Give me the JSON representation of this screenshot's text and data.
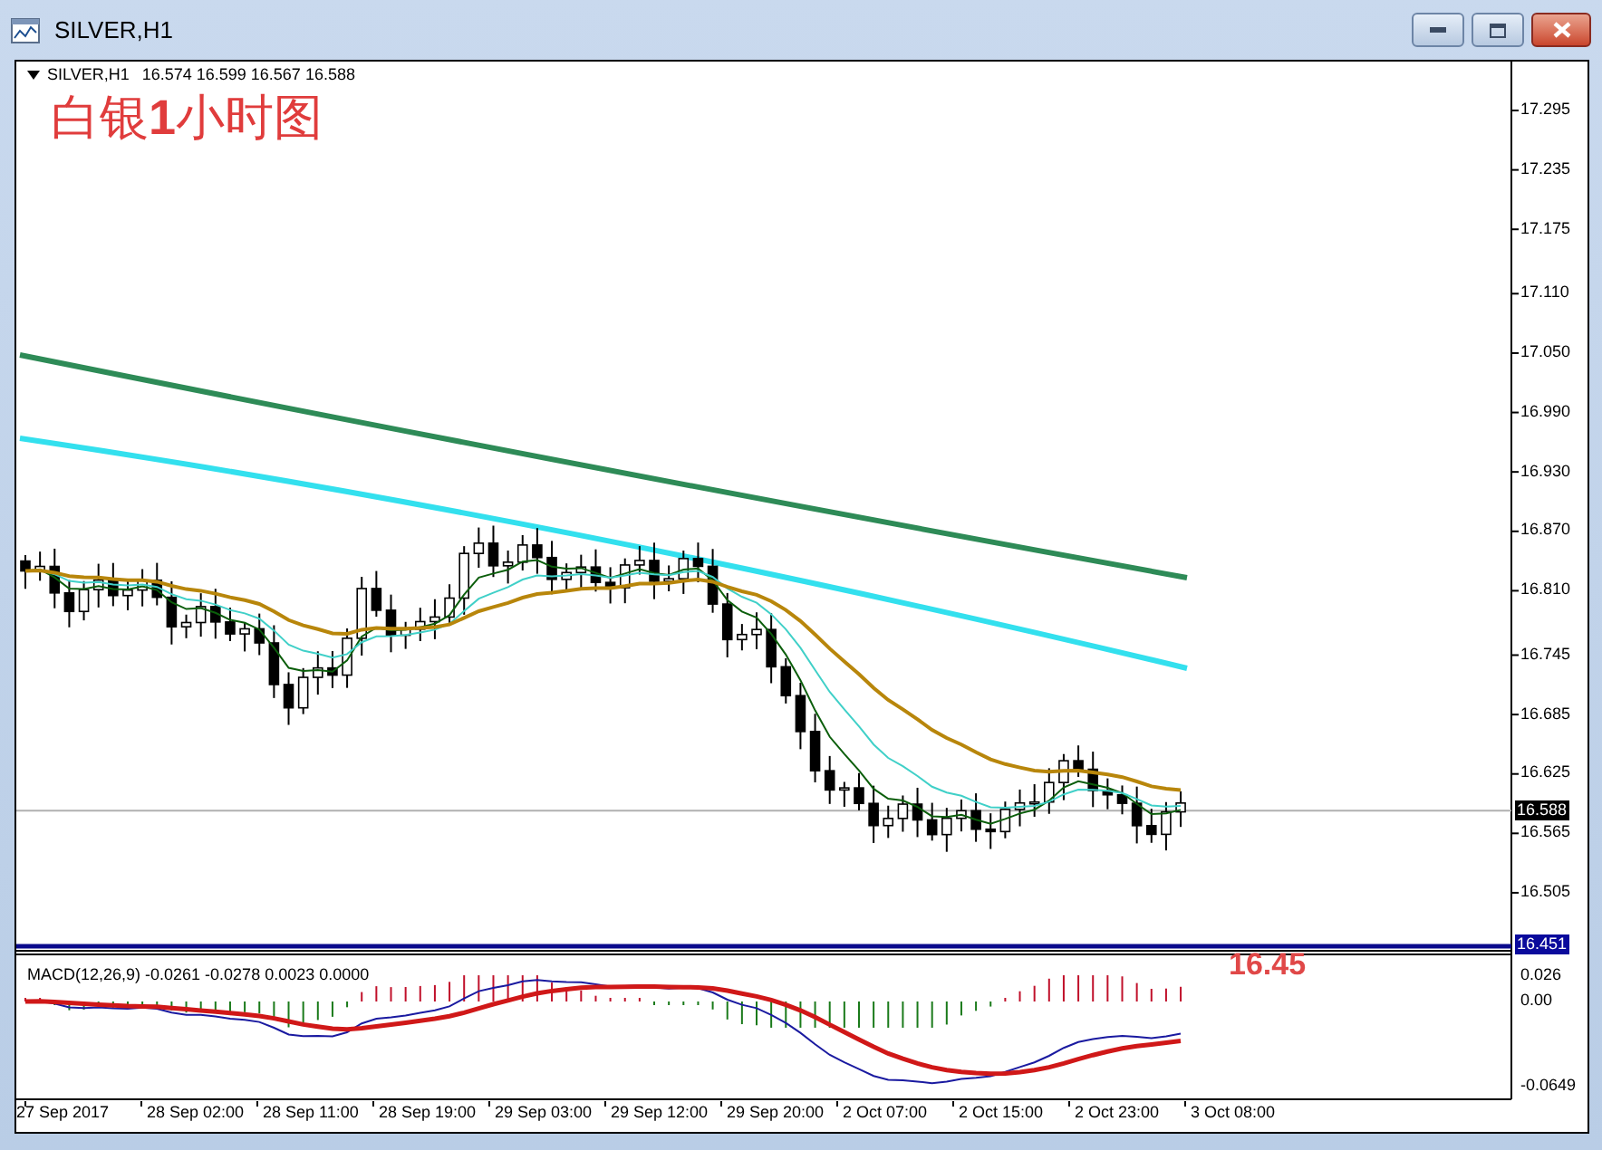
{
  "window": {
    "title": "SILVER,H1"
  },
  "chart": {
    "symbol": "SILVER,H1",
    "quote": "16.574 16.599 16.567 16.588",
    "overlay_title": "白银**1**小时图",
    "level_annotation": "16.45"
  },
  "price_axis": {
    "ticks": [
      "17.295",
      "17.235",
      "17.175",
      "17.110",
      "17.050",
      "16.990",
      "16.930",
      "16.870",
      "16.810",
      "16.745",
      "16.685",
      "16.625",
      "16.565",
      "16.505"
    ],
    "bid_label": "16.588",
    "level_label": "16.451"
  },
  "macd": {
    "label": "MACD(12,26,9) -0.0261 -0.0278 0.0023 0.0000",
    "ticks": [
      "0.026",
      "0.00",
      "-0.0649"
    ]
  },
  "time_axis": [
    "27 Sep 2017",
    "28 Sep 02:00",
    "28 Sep 11:00",
    "28 Sep 19:00",
    "29 Sep 03:00",
    "29 Sep 12:00",
    "29 Sep 20:00",
    "2 Oct 07:00",
    "2 Oct 15:00",
    "2 Oct 23:00",
    "3 Oct 08:00"
  ]
}
